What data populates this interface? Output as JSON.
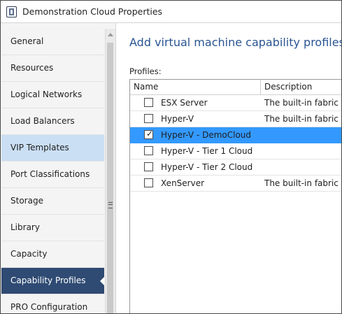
{
  "window": {
    "title": "Demonstration Cloud Properties",
    "icon": "app-window-icon"
  },
  "sidebar": {
    "items": [
      {
        "label": "General",
        "state": "normal"
      },
      {
        "label": "Resources",
        "state": "normal"
      },
      {
        "label": "Logical Networks",
        "state": "normal"
      },
      {
        "label": "Load Balancers",
        "state": "normal"
      },
      {
        "label": "VIP Templates",
        "state": "hover"
      },
      {
        "label": "Port Classifications",
        "state": "normal"
      },
      {
        "label": "Storage",
        "state": "normal"
      },
      {
        "label": "Library",
        "state": "normal"
      },
      {
        "label": "Capacity",
        "state": "normal"
      },
      {
        "label": "Capability Profiles",
        "state": "selected"
      },
      {
        "label": "PRO Configuration",
        "state": "normal"
      }
    ],
    "scrollbar_grip_icon": "grip-lines-icon"
  },
  "main": {
    "heading": "Add virtual machine capability profiles for t",
    "profiles_label": "Profiles:",
    "table": {
      "columns": [
        "Name",
        "Description"
      ],
      "rows": [
        {
          "name": "ESX Server",
          "description": "The built-in fabric ca",
          "checked": false,
          "selected": false
        },
        {
          "name": "Hyper-V",
          "description": "The built-in fabric ca",
          "checked": false,
          "selected": false
        },
        {
          "name": "Hyper-V - DemoCloud",
          "description": "",
          "checked": true,
          "selected": true
        },
        {
          "name": "Hyper-V - Tier 1 Cloud",
          "description": "",
          "checked": false,
          "selected": false
        },
        {
          "name": "Hyper-V - Tier 2 Cloud",
          "description": "",
          "checked": false,
          "selected": false
        },
        {
          "name": "XenServer",
          "description": "The built-in fabric ca",
          "checked": false,
          "selected": false
        }
      ]
    }
  },
  "colors": {
    "accent_heading": "#2a5592",
    "sidebar_selected": "#2f4b73",
    "sidebar_hover": "#cbdff4",
    "row_selected": "#3399ff"
  }
}
